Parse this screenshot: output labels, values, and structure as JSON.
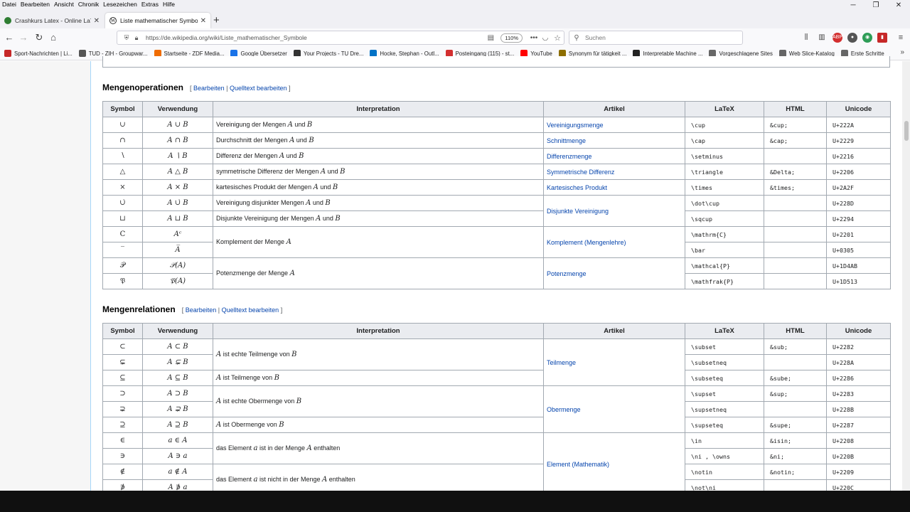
{
  "menubar": [
    "Datei",
    "Bearbeiten",
    "Ansicht",
    "Chronik",
    "Lesezeichen",
    "Extras",
    "Hilfe"
  ],
  "window_controls": [
    "─",
    "❐",
    "✕"
  ],
  "tabs": [
    {
      "title": "Crashkurs Latex - Online LaTe",
      "close": "✕",
      "favicon_color": "#2e7d32"
    },
    {
      "title": "Liste mathematischer Symbole",
      "close": "✕",
      "favicon_color": "#333333"
    }
  ],
  "newtab_label": "+",
  "nav": {
    "url": "https://de.wikipedia.org/wiki/Liste_mathematischer_Symbole",
    "zoom": "110%",
    "more": "•••",
    "search_placeholder": "Suchen"
  },
  "bookmarks": [
    {
      "label": "Sport-Nachrichten | Li...",
      "color": "#c62828"
    },
    {
      "label": "TUD - ZIH - Groupwar...",
      "color": "#555555"
    },
    {
      "label": "Startseite - ZDF Media...",
      "color": "#ef6c00"
    },
    {
      "label": "Google Übersetzer",
      "color": "#1a73e8"
    },
    {
      "label": "Your Projects - TU Dre...",
      "color": "#333333"
    },
    {
      "label": "Hocke, Stephan - Outl...",
      "color": "#0072c6"
    },
    {
      "label": "Posteingang (115) - st...",
      "color": "#d32f2f"
    },
    {
      "label": "YouTube",
      "color": "#ff0000"
    },
    {
      "label": "Synonym für tätigkeit ...",
      "color": "#8d6e00"
    },
    {
      "label": "Interpretable Machine ...",
      "color": "#222222"
    },
    {
      "label": "Vorgeschlagene Sites",
      "color": "#666666"
    },
    {
      "label": "Web Slice-Katalog",
      "color": "#666666"
    },
    {
      "label": "Erste Schritte",
      "color": "#666666"
    }
  ],
  "bookmarks_overflow": "»",
  "edit_links": {
    "open": "[",
    "edit": "Bearbeiten",
    "sep": "|",
    "source": "Quelltext bearbeiten",
    "close": "]"
  },
  "columns": [
    "Symbol",
    "Verwendung",
    "Interpretation",
    "Artikel",
    "LaTeX",
    "HTML",
    "Unicode"
  ],
  "sections": [
    {
      "title": "Mengenoperationen",
      "rows": [
        {
          "symbol": "∪",
          "usage": "A ∪ B",
          "interp": "Vereinigung der Mengen A und B",
          "article": "Vereinigungsmenge",
          "latex": "\\cup",
          "html": "&cup;",
          "unicode": "U+222A"
        },
        {
          "symbol": "∩",
          "usage": "A ∩ B",
          "interp": "Durchschnitt der Mengen A und B",
          "article": "Schnittmenge",
          "latex": "\\cap",
          "html": "&cap;",
          "unicode": "U+2229"
        },
        {
          "symbol": "∖",
          "usage": "A ∖ B",
          "interp": "Differenz der Mengen A und B",
          "article": "Differenzmenge",
          "latex": "\\setminus",
          "html": "",
          "unicode": "U+2216"
        },
        {
          "symbol": "△",
          "usage": "A △ B",
          "interp": "symmetrische Differenz der Mengen A und B",
          "article": "Symmetrische Differenz",
          "latex": "\\triangle",
          "html": "&Delta;",
          "unicode": "U+2206"
        },
        {
          "symbol": "×",
          "usage": "A × B",
          "interp": "kartesisches Produkt der Mengen A und B",
          "article": "Kartesisches Produkt",
          "latex": "\\times",
          "html": "&times;",
          "unicode": "U+2A2F"
        },
        {
          "symbol": "∪̇",
          "usage": "A ∪̇ B",
          "interp": "Vereinigung disjunkter Mengen A und B",
          "article": "Disjunkte Vereinigung",
          "latex": "\\dot\\cup",
          "html": "",
          "unicode": "U+228D"
        },
        {
          "symbol": "⊔",
          "usage": "A ⊔ B",
          "interp": "Disjunkte Vereinigung der Mengen A und B",
          "article": "",
          "latex": "\\sqcup",
          "html": "",
          "unicode": "U+2294"
        },
        {
          "symbol": "C",
          "usage": "Aᶜ",
          "interp": "Komplement der Menge A",
          "article": "Komplement (Mengenlehre)",
          "latex": "\\mathrm{C}",
          "html": "",
          "unicode": "U+2201"
        },
        {
          "symbol": "‾",
          "usage": "A̅",
          "interp": "",
          "article": "",
          "latex": "\\bar",
          "html": "",
          "unicode": "U+0305"
        },
        {
          "symbol": "𝒫",
          "usage": "𝒫(A)",
          "interp": "Potenzmenge der Menge A",
          "article": "Potenzmenge",
          "latex": "\\mathcal{P}",
          "html": "",
          "unicode": "U+1D4AB"
        },
        {
          "symbol": "𝔓",
          "usage": "𝔓(A)",
          "interp": "",
          "article": "",
          "latex": "\\mathfrak{P}",
          "html": "",
          "unicode": "U+1D513"
        }
      ]
    },
    {
      "title": "Mengenrelationen",
      "rows": [
        {
          "symbol": "⊂",
          "usage": "A ⊂ B",
          "interp": "A ist echte Teilmenge von B",
          "article": "Teilmenge",
          "latex": "\\subset",
          "html": "&sub;",
          "unicode": "U+2282"
        },
        {
          "symbol": "⊊",
          "usage": "A ⊊ B",
          "interp": "",
          "article": "",
          "latex": "\\subsetneq",
          "html": "",
          "unicode": "U+228A"
        },
        {
          "symbol": "⊆",
          "usage": "A ⊆ B",
          "interp": "A ist Teilmenge von B",
          "article": "",
          "latex": "\\subseteq",
          "html": "&sube;",
          "unicode": "U+2286"
        },
        {
          "symbol": "⊃",
          "usage": "A ⊃ B",
          "interp": "A ist echte Obermenge von B",
          "article": "Obermenge",
          "latex": "\\supset",
          "html": "&sup;",
          "unicode": "U+2283"
        },
        {
          "symbol": "⊋",
          "usage": "A ⊋ B",
          "interp": "",
          "article": "",
          "latex": "\\supsetneq",
          "html": "",
          "unicode": "U+228B"
        },
        {
          "symbol": "⊇",
          "usage": "A ⊇ B",
          "interp": "A ist Obermenge von B",
          "article": "",
          "latex": "\\supseteq",
          "html": "&supe;",
          "unicode": "U+2287"
        },
        {
          "symbol": "∈",
          "usage": "a ∈ A",
          "interp": "das Element a ist in der Menge A enthalten",
          "article": "Element (Mathematik)",
          "latex": "\\in",
          "html": "&isin;",
          "unicode": "U+2208"
        },
        {
          "symbol": "∋",
          "usage": "A ∋ a",
          "interp": "",
          "article": "",
          "latex": "\\ni , \\owns",
          "html": "&ni;",
          "unicode": "U+220B"
        },
        {
          "symbol": "∉",
          "usage": "a ∉ A",
          "interp": "das Element a ist nicht in der Menge A enthalten",
          "article": "",
          "latex": "\\notin",
          "html": "&notin;",
          "unicode": "U+2209"
        },
        {
          "symbol": "∌",
          "usage": "A ∌ a",
          "interp": "",
          "article": "",
          "latex": "\\not\\ni",
          "html": "",
          "unicode": "U+220C"
        }
      ]
    }
  ],
  "colors": {
    "link": "#0645ad",
    "header_bg": "#eaecf0",
    "border": "#a2a9b1"
  }
}
